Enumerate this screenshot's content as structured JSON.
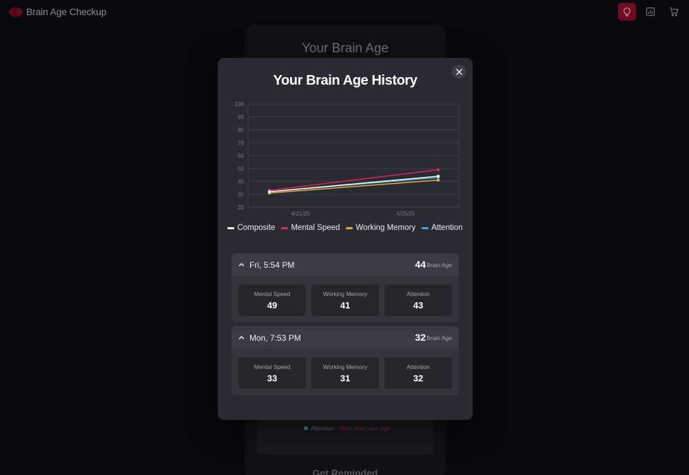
{
  "app": {
    "title": "Brain Age Checkup",
    "nav": [
      {
        "name": "brain",
        "icon": "brain-icon",
        "active": true
      },
      {
        "name": "chart",
        "icon": "chart-icon",
        "active": false
      },
      {
        "name": "cart",
        "icon": "cart-icon",
        "active": false
      }
    ]
  },
  "background": {
    "title": "Your Brain Age",
    "attention_label": "Attention:",
    "attention_status": "Older than your age",
    "reminded_heading": "Get Reminded"
  },
  "modal": {
    "title": "Your Brain Age History",
    "close_icon": "close-icon"
  },
  "chart_data": {
    "type": "line",
    "x_ticks": [
      "4/21/25",
      "4/25/25"
    ],
    "y_ticks": [
      100,
      90,
      80,
      70,
      60,
      50,
      40,
      30,
      20
    ],
    "ylim": [
      20,
      100
    ],
    "grid": true,
    "legend_position": "bottom",
    "x": [
      "Mon, 7:53 PM",
      "Fri, 5:54 PM"
    ],
    "series": [
      {
        "name": "Composite",
        "color": "#ffffff",
        "values": [
          32,
          44
        ]
      },
      {
        "name": "Mental Speed",
        "color": "#e2245a",
        "values": [
          33,
          49
        ]
      },
      {
        "name": "Working Memory",
        "color": "#f0a93a",
        "values": [
          31,
          41
        ]
      },
      {
        "name": "Attention",
        "color": "#3ab0dc",
        "values": [
          32,
          43
        ]
      }
    ]
  },
  "sessions": [
    {
      "date": "Fri, 5:54 PM",
      "brain_age": "44",
      "brain_age_label": "Brain Age",
      "metrics": [
        {
          "label": "Mental Speed",
          "value": "49"
        },
        {
          "label": "Working Memory",
          "value": "41"
        },
        {
          "label": "Attention",
          "value": "43"
        }
      ]
    },
    {
      "date": "Mon, 7:53 PM",
      "brain_age": "32",
      "brain_age_label": "Brain Age",
      "metrics": [
        {
          "label": "Mental Speed",
          "value": "33"
        },
        {
          "label": "Working Memory",
          "value": "31"
        },
        {
          "label": "Attention",
          "value": "32"
        }
      ]
    }
  ]
}
